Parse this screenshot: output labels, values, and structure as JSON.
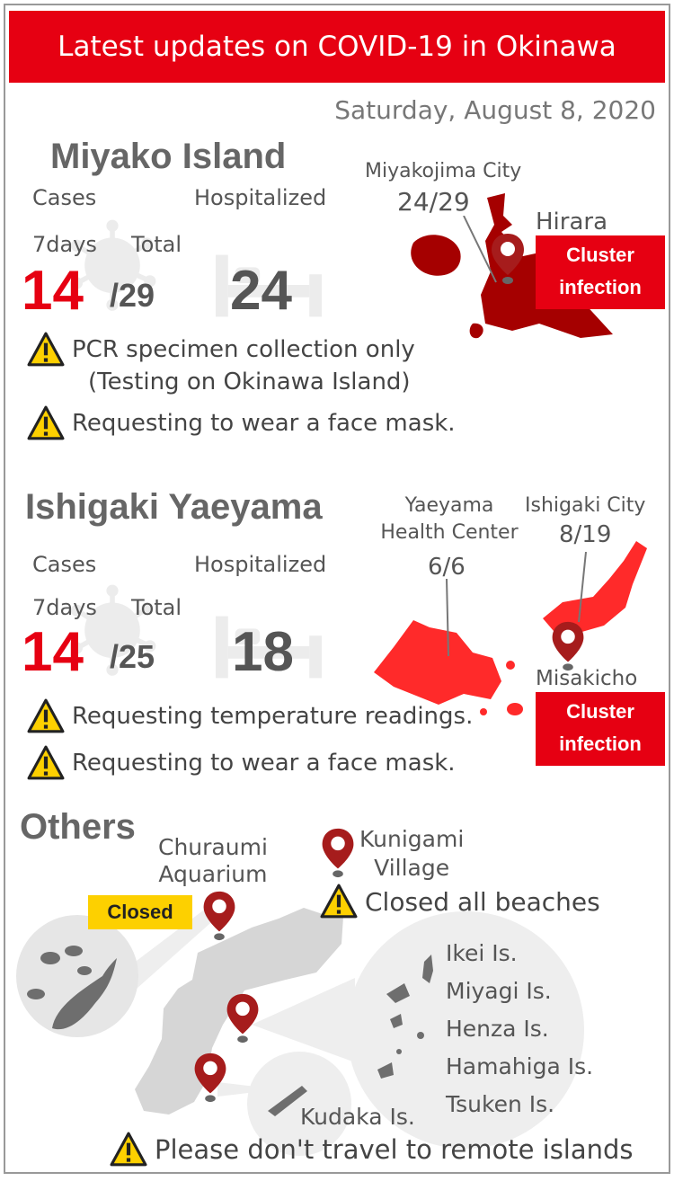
{
  "header": {
    "title": "Latest updates on COVID-19 in Okinawa",
    "date": "Saturday, August 8, 2020"
  },
  "miyako": {
    "title": "Miyako Island",
    "cases_label": "Cases",
    "hospitalized_label": "Hospitalized",
    "days_label": "7days",
    "total_label": "Total",
    "seven_days": "14",
    "total": "/29",
    "hospitalized": "24",
    "city_name": "Miyakojima City",
    "city_value": "24/29",
    "place": "Hirara",
    "cluster": [
      "Cluster",
      "infection"
    ],
    "notices": [
      "PCR specimen collection only",
      "(Testing on Okinawa Island)",
      "Requesting to wear a face mask."
    ]
  },
  "ishigaki": {
    "title": "Ishigaki Yaeyama",
    "cases_label": "Cases",
    "hospitalized_label": "Hospitalized",
    "days_label": "7days",
    "total_label": "Total",
    "seven_days": "14",
    "total": "/25",
    "hospitalized": "18",
    "center_name": [
      "Yaeyama",
      "Health Center"
    ],
    "center_value": "6/6",
    "city_name": "Ishigaki City",
    "city_value": "8/19",
    "place": "Misakicho",
    "cluster": [
      "Cluster",
      "infection"
    ],
    "notices": [
      "Requesting temperature readings.",
      "Requesting to wear a face mask."
    ]
  },
  "others": {
    "title": "Others",
    "aquarium": [
      "Churaumi",
      "Aquarium"
    ],
    "closed_badge": "Closed",
    "kunigami": [
      "Kunigami",
      "Village"
    ],
    "kunigami_notice": "Closed all beaches",
    "islands": [
      "Ikei Is.",
      "Miyagi Is.",
      "Henza Is.",
      "Hamahiga Is.",
      "Tsuken Is."
    ],
    "kudaka": "Kudaka Is.",
    "travel_notice": "Please don't travel to remote islands"
  },
  "colors": {
    "accent_red": "#e60012",
    "miyako_map": "#a50000",
    "ishigaki_map": "#ff2a2a",
    "pin": "#a61c1c",
    "badge_yellow": "#fdd000",
    "map_grey": "#d6d6d6"
  }
}
